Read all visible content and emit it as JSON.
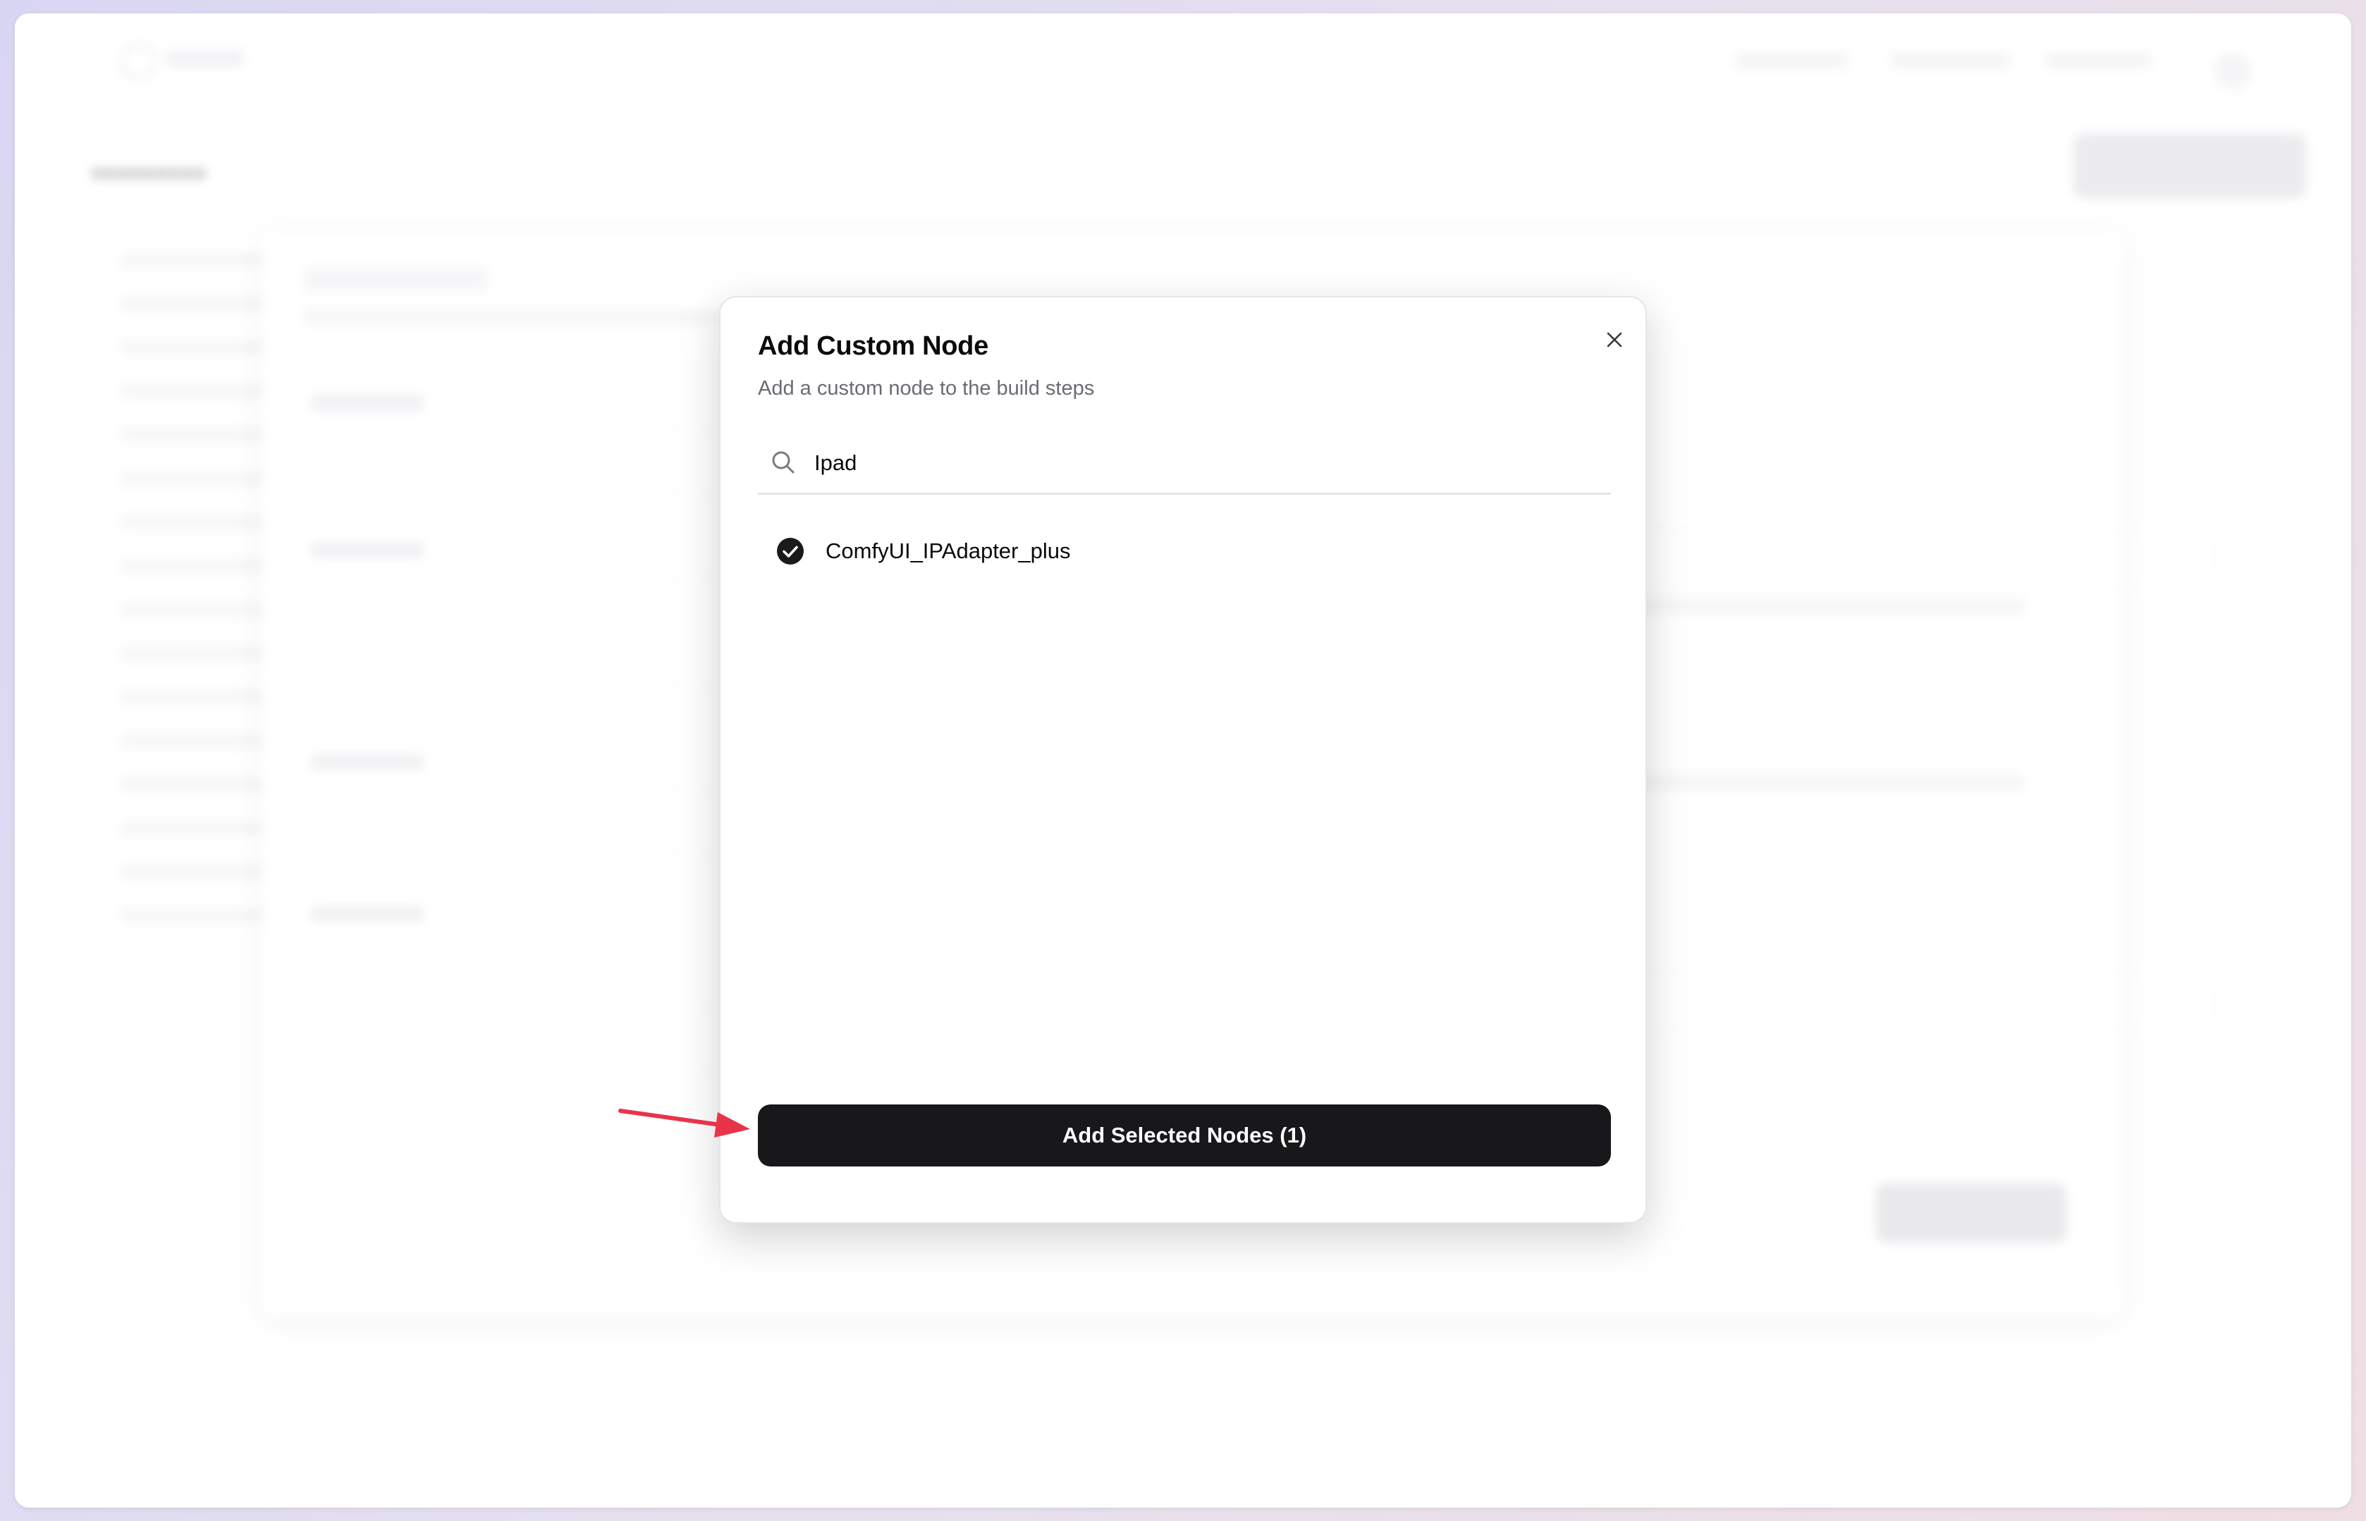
{
  "modal": {
    "title": "Add Custom Node",
    "description": "Add a custom node to the build steps",
    "search": {
      "value": "Ipad"
    },
    "results": [
      {
        "label": "ComfyUI_IPAdapter_plus",
        "checked": true
      }
    ],
    "add_button_label": "Add Selected Nodes (1)"
  },
  "colors": {
    "primary_button": "#18181b",
    "annotation_arrow": "#e8344a",
    "check_fill": "#1a1a1a"
  },
  "icons": {
    "close": "close-icon",
    "search": "search-icon",
    "check": "check-circle-icon",
    "annotation": "arrow-icon"
  }
}
